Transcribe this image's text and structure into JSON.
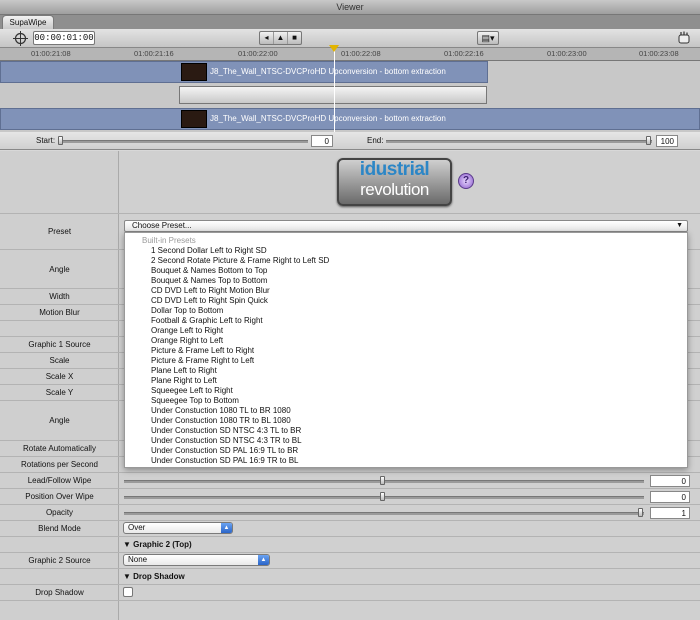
{
  "window": {
    "title": "Viewer"
  },
  "tabs": [
    {
      "label": "SupaWipe"
    }
  ],
  "toolbar": {
    "timecode": "00:00:01:00"
  },
  "ruler": {
    "ticks": [
      "01:00:21:08",
      "01:00:21:16",
      "01:00:22:00",
      "01:00:22:08",
      "01:00:22:16",
      "01:00:23:00",
      "01:00:23:08"
    ]
  },
  "clips": {
    "top": "J8_The_Wall_NTSC-DVCProHD Upconversion - bottom extraction",
    "bottom": "J8_The_Wall_NTSC-DVCProHD Upconversion - bottom extraction"
  },
  "range": {
    "start_label": "Start:",
    "start_value": "0",
    "end_label": "End:",
    "end_value": "100"
  },
  "logo": {
    "line1": "idustrial",
    "line2": "revolution",
    "help": "?"
  },
  "params": {
    "preset_label": "Preset",
    "angle_label": "Angle",
    "width_label": "Width",
    "motion_blur_label": "Motion Blur",
    "graphic1_source_label": "Graphic 1 Source",
    "scale_label": "Scale",
    "scale_x_label": "Scale X",
    "scale_y_label": "Scale Y",
    "angle2_label": "Angle",
    "rotate_auto_label": "Rotate Automatically",
    "rotations_label": "Rotations per Second",
    "lead_follow_label": "Lead/Follow Wipe",
    "lead_follow_value": "0",
    "position_over_label": "Position Over Wipe",
    "position_over_value": "0",
    "opacity_label": "Opacity",
    "opacity_value": "1",
    "blend_mode_label": "Blend Mode",
    "blend_mode_value": "Over",
    "graphic2_section": "Graphic 2 (Top)",
    "graphic2_source_label": "Graphic 2 Source",
    "graphic2_source_value": "None",
    "drop_shadow_section": "Drop Shadow",
    "drop_shadow_label": "Drop Shadow"
  },
  "preset": {
    "selected": "Choose Preset...",
    "group_header": "Built-in Presets",
    "options": [
      "1 Second Dollar Left to Right SD",
      "2 Second Rotate Picture & Frame Right to Left SD",
      "Bouquet & Names Bottom to Top",
      "Bouquet & Names Top to Bottom",
      "CD DVD Left to Right Motion Blur",
      "CD DVD Left to Right Spin Quick",
      "Dollar Top to Bottom",
      "Football & Graphic Left to Right",
      "Orange Left to Right",
      "Orange Right to Left",
      "Picture & Frame Left to Right",
      "Picture & Frame Right to Left",
      "Plane Left to Right",
      "Plane Right to Left",
      "Squeegee Left to Right",
      "Squeegee Top to Bottom",
      "Under Constuction 1080 TL to BR 1080",
      "Under Constuction 1080 TR to BL 1080",
      "Under Constuction SD NTSC 4:3 TL to BR",
      "Under Constuction SD NTSC 4:3 TR to BL",
      "Under Constuction SD PAL 16:9 TL to BR",
      "Under Constuction SD PAL 16:9 TR to BL"
    ]
  }
}
